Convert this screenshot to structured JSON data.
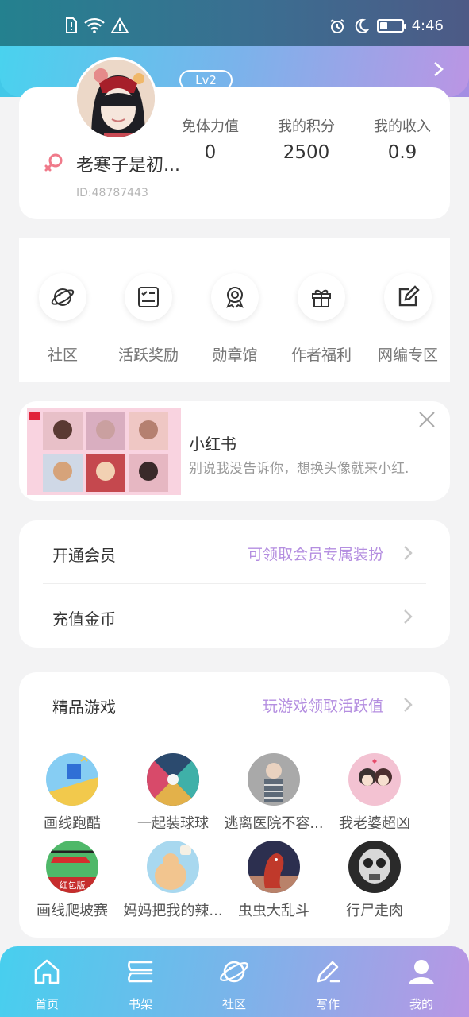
{
  "status_bar": {
    "time": "4:46",
    "battery_level": 0.35,
    "icons": [
      "sim-alert-icon",
      "wifi-icon",
      "warning-icon",
      "alarm-icon",
      "moon-icon",
      "battery-icon"
    ]
  },
  "profile": {
    "level": "Lv2",
    "username": "老寒子是初...",
    "user_id": "ID:48787443",
    "gender_icon": "female-icon",
    "stats": [
      {
        "label": "免体力值",
        "value": "0"
      },
      {
        "label": "我的积分",
        "value": "2500"
      },
      {
        "label": "我的收入",
        "value": "0.9"
      }
    ]
  },
  "menu": {
    "items": [
      {
        "label": "社区",
        "icon": "planet-icon"
      },
      {
        "label": "活跃奖励",
        "icon": "checklist-icon"
      },
      {
        "label": "勋章馆",
        "icon": "medal-icon"
      },
      {
        "label": "作者福利",
        "icon": "gift-icon"
      },
      {
        "label": "网编专区",
        "icon": "edit-icon"
      }
    ]
  },
  "ad": {
    "title": "小红书",
    "description": "别说我没告诉你，想换头像就来小红."
  },
  "vip": {
    "rows": [
      {
        "title": "开通会员",
        "hint": "可领取会员专属装扮"
      },
      {
        "title": "充值金币",
        "hint": ""
      }
    ]
  },
  "games": {
    "title": "精品游戏",
    "hint": "玩游戏领取活跃值",
    "items": [
      {
        "name": "画线跑酷",
        "color": "#7fc7f0"
      },
      {
        "name": "一起装球球",
        "color": "#2b4a6e"
      },
      {
        "name": "逃离医院不容...",
        "color": "#9b9b9b"
      },
      {
        "name": "我老婆超凶",
        "color": "#f3c2d2"
      },
      {
        "name": "画线爬坡赛",
        "color": "#4fb869"
      },
      {
        "name": "妈妈把我的辣...",
        "color": "#a8d8ef"
      },
      {
        "name": "虫虫大乱斗",
        "color": "#2c2f4f"
      },
      {
        "name": "行尸走肉",
        "color": "#2a2a2a"
      }
    ],
    "badge_text": "红包版"
  },
  "bottom_nav": {
    "items": [
      {
        "label": "首页",
        "icon": "home-icon"
      },
      {
        "label": "书架",
        "icon": "bookshelf-icon"
      },
      {
        "label": "社区",
        "icon": "planet-icon"
      },
      {
        "label": "写作",
        "icon": "pen-icon"
      },
      {
        "label": "我的",
        "icon": "user-icon"
      }
    ],
    "active_index": 4
  },
  "colors": {
    "accent_purple": "#b48ee0",
    "gradient_start": "#47cfee",
    "gradient_end": "#b996e4"
  }
}
